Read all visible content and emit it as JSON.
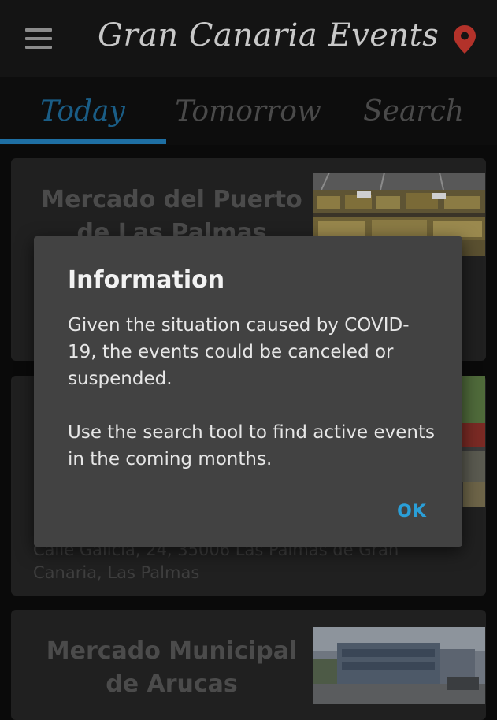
{
  "app": {
    "title": "Gran Canaria Events",
    "menu_icon": "hamburger-menu-icon",
    "location_icon": "map-pin-icon",
    "accent_color": "#1e6fa3",
    "pin_color": "#b3322a"
  },
  "tabs": [
    {
      "label": "Today",
      "active": true
    },
    {
      "label": "Tomorrow",
      "active": false
    },
    {
      "label": "Search",
      "active": false
    }
  ],
  "events": [
    {
      "title": "Mercado del Puerto de Las Palmas",
      "address": ""
    },
    {
      "title": "",
      "address": "Calle Galicia, 24, 35006 Las Palmas de Gran Canaria, Las Palmas"
    },
    {
      "title": "Mercado Municipal de Arucas",
      "address": ""
    }
  ],
  "dialog": {
    "title": "Information",
    "body_1": "Given the situation caused by COVID-19, the events could be canceled or suspended.",
    "body_2": "Use the search tool to find active events in the coming months.",
    "ok_label": "OK"
  }
}
